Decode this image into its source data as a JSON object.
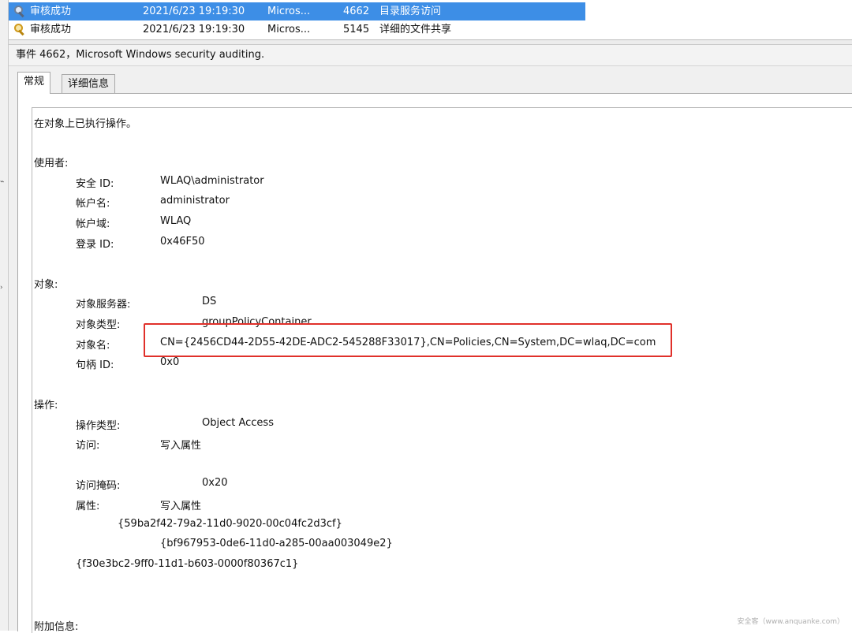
{
  "events": [
    {
      "level": "审核成功",
      "datetime": "2021/6/23 19:19:30",
      "source": "Micros...",
      "event_id": "4662",
      "task": "目录服务访问",
      "icon": "magnifier-key-icon",
      "selected": true
    },
    {
      "level": "审核成功",
      "datetime": "2021/6/23 19:19:30",
      "source": "Micros...",
      "event_id": "5145",
      "task": "详细的文件共享",
      "icon": "key-icon",
      "selected": false
    }
  ],
  "event_header": "事件 4662，Microsoft Windows security auditing.",
  "tabs": {
    "general": "常规",
    "details": "详细信息"
  },
  "details": {
    "summary": "在对象上已执行操作。",
    "subject_label": "使用者:",
    "security_id_label": "安全 ID:",
    "security_id": "WLAQ\\administrator",
    "account_name_label": "帐户名:",
    "account_name": "administrator",
    "account_domain_label": "帐户域:",
    "account_domain": "WLAQ",
    "logon_id_label": "登录 ID:",
    "logon_id": "0x46F50",
    "object_label": "对象:",
    "object_server_label": "对象服务器:",
    "object_server": "DS",
    "object_type_label": "对象类型:",
    "object_type": "groupPolicyContainer",
    "object_name_label": "对象名:",
    "object_name": "CN={2456CD44-2D55-42DE-ADC2-545288F33017},CN=Policies,CN=System,DC=wlaq,DC=com",
    "handle_id_label": "句柄 ID:",
    "handle_id": "0x0",
    "operation_label": "操作:",
    "operation_type_label": "操作类型:",
    "operation_type": "Object Access",
    "access_label": "访问:",
    "access": "写入属性",
    "access_mask_label": "访问掩码:",
    "access_mask": "0x20",
    "properties_label": "属性:",
    "properties": "写入属性",
    "guid1": "{59ba2f42-79a2-11d0-9020-00c04fc2d3cf}",
    "guid2": "{bf967953-0de6-11d0-a285-00aa003049e2}",
    "guid3": "{f30e3bc2-9ff0-11d1-b603-0000f80367c1}",
    "additional_info_label": "附加信息:"
  },
  "watermark": "安全客（www.anquanke.com）",
  "colors": {
    "selection": "#3d8ee6",
    "highlight": "#e0302a"
  }
}
